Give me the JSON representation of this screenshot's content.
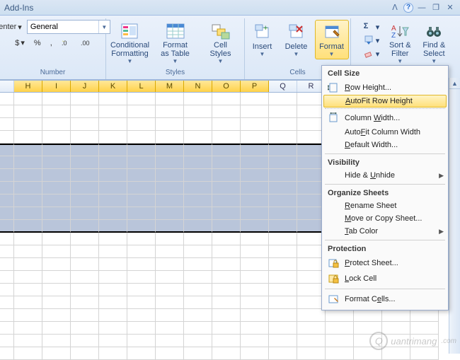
{
  "title": "Add-Ins",
  "ribbon": {
    "number": {
      "format_value": "General",
      "label": "Number",
      "center_btn": "enter",
      "currency": "$",
      "percent": "%",
      "comma": ","
    },
    "styles": {
      "cond_fmt": "Conditional\nFormatting",
      "fmt_table": "Format\nas Table",
      "cell_styles": "Cell\nStyles",
      "label": "Styles"
    },
    "cells": {
      "insert": "Insert",
      "delete": "Delete",
      "format": "Format",
      "label": "Cells"
    },
    "editing": {
      "sum": "Σ",
      "fill": "▾",
      "clear": "⌫",
      "sort": "Sort &\nFilter",
      "find": "Find &\nSelect"
    }
  },
  "columns": [
    "H",
    "I",
    "J",
    "K",
    "L",
    "M",
    "N",
    "O",
    "P"
  ],
  "menu": {
    "cell_size": "Cell Size",
    "row_height": "Row Height...",
    "autofit_row": "AutoFit Row Height",
    "col_width": "Column Width...",
    "autofit_col": "AutoFit Column Width",
    "default_width": "Default Width...",
    "visibility": "Visibility",
    "hide_unhide": "Hide & Unhide",
    "organize": "Organize Sheets",
    "rename": "Rename Sheet",
    "move_copy": "Move or Copy Sheet...",
    "tab_color": "Tab Color",
    "protection": "Protection",
    "protect_sheet": "Protect Sheet...",
    "lock_cell": "Lock Cell",
    "format_cells": "Format Cells..."
  },
  "watermark": "uantrimang"
}
